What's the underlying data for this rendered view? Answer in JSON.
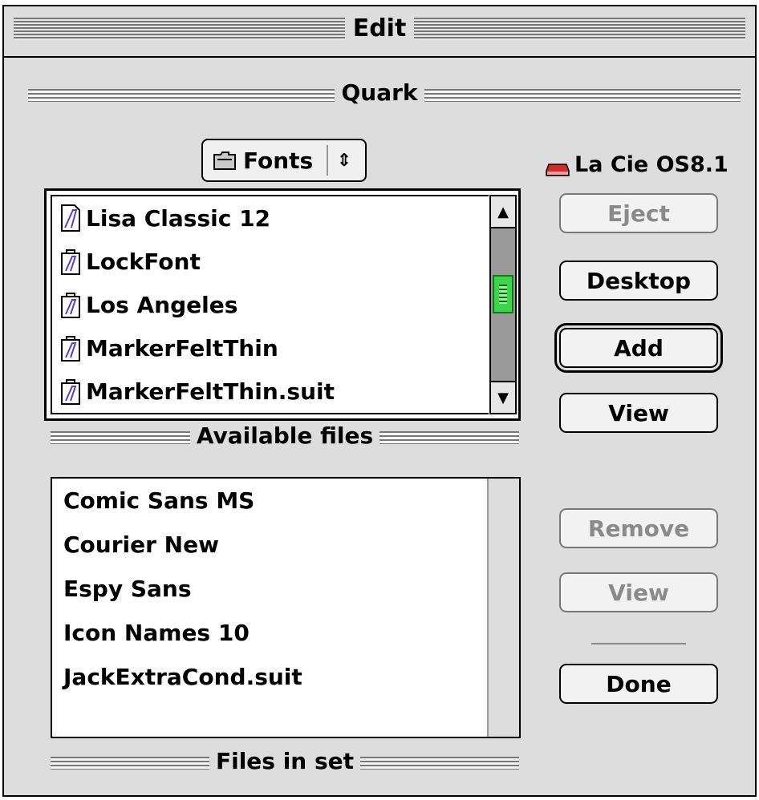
{
  "window": {
    "title": "Edit"
  },
  "section": {
    "title": "Quark"
  },
  "folder_popup": {
    "label": "Fonts",
    "icon": "folder-icon",
    "arrows": "⇕"
  },
  "volume": {
    "name": "La Cie OS8.1",
    "icon": "hard-disk-icon"
  },
  "available_files": {
    "label": "Available files",
    "items": [
      "Lisa Classic 12",
      "LockFont",
      "Los Angeles",
      "MarkerFeltThin",
      "MarkerFeltThin.suit"
    ],
    "scroll_position": 0.55
  },
  "files_in_set": {
    "label": "Files in set",
    "items": [
      "Comic Sans MS",
      "Courier New",
      "Espy Sans",
      "Icon Names 10",
      "JackExtraCond.suit"
    ]
  },
  "buttons": {
    "eject": "Eject",
    "desktop": "Desktop",
    "add": "Add",
    "view_top": "View",
    "remove": "Remove",
    "view_bottom": "View",
    "done": "Done"
  },
  "colors": {
    "thumb": "#3dd34b",
    "disk": "#d22b2b",
    "font_icon": "#5b3fc4"
  }
}
